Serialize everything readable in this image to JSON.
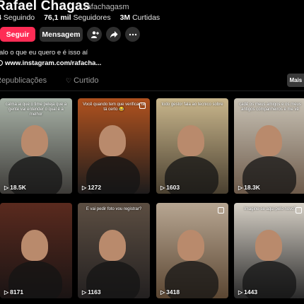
{
  "profile": {
    "name": "Rafael Chagas",
    "handle": "rafachagasm",
    "stats": [
      {
        "value": "4",
        "label": "Seguindo"
      },
      {
        "value": "76,1 mil",
        "label": "Seguidores"
      },
      {
        "value": "3M",
        "label": "Curtidas"
      }
    ],
    "follow_label": "Seguir",
    "message_label": "Mensagem",
    "bio": "alo o que eu quero e é isso aí",
    "link": "www.instagram.com/rafacha..."
  },
  "tabs": [
    {
      "label": "Republicações",
      "icon": "repost-icon"
    },
    {
      "label": "Curtido",
      "icon": "heart-icon"
    }
  ],
  "more_label": "Mais r",
  "videos": [
    {
      "caption": "calma ai que o time peleja que a gente vai entender o qual é a melhor",
      "views": "18.5K",
      "badge": false,
      "bg1": "#a9b3a8",
      "bg2": "#3d3b38"
    },
    {
      "caption": "Você quando tem que verificar ta tá certo 😂",
      "views": "1272",
      "badge": true,
      "bg1": "#b0521f",
      "bg2": "#1e1c1c"
    },
    {
      "caption": "todo gestor fala ao tecnico sobre",
      "views": "1603",
      "badge": false,
      "bg1": "#c9b68c",
      "bg2": "#4a4030"
    },
    {
      "caption": "cadê os meus amigos e os meus antigos companheiros e me vê",
      "views": "18.3K",
      "badge": false,
      "bg1": "#c8c2b5",
      "bg2": "#6d5a4a"
    },
    {
      "caption": "",
      "views": "8171",
      "badge": false,
      "bg1": "#5a2a1e",
      "bg2": "#1a1414"
    },
    {
      "caption": "E vai pedir foto vou registrar?",
      "views": "1163",
      "badge": false,
      "bg1": "#5c4e42",
      "bg2": "#232020"
    },
    {
      "caption": "",
      "views": "3418",
      "badge": true,
      "bg1": "#b7a692",
      "bg2": "#5b4632"
    },
    {
      "caption": "Imagine-se aqui pelo novo?",
      "views": "1443",
      "badge": true,
      "bg1": "#d6d0c6",
      "bg2": "#2a2a2a"
    }
  ]
}
